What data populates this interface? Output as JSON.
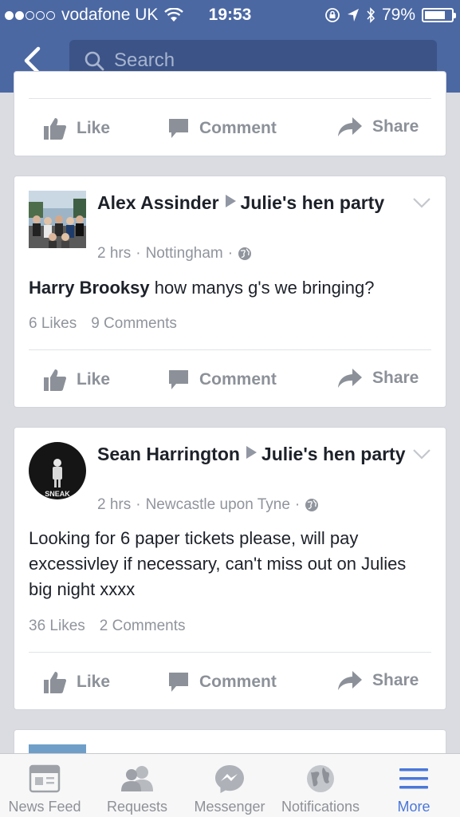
{
  "status_bar": {
    "carrier": "vodafone UK",
    "time": "19:53",
    "battery": "79%",
    "battery_level": 0.79
  },
  "search": {
    "placeholder": "Search"
  },
  "actions": {
    "like": "Like",
    "comment": "Comment",
    "share": "Share"
  },
  "posts": [
    {
      "author": "Alex Assinder",
      "group": "Julie's hen party",
      "time": "2 hrs",
      "location": "Nottingham",
      "mention": "Harry Brooksy",
      "text": " how manys g's we bringing?",
      "likes": "6 Likes",
      "comments": "9 Comments"
    },
    {
      "author": "Sean Harrington",
      "group": "Julie's hen party",
      "time": "2 hrs",
      "location": "Newcastle upon Tyne",
      "text": "Looking for 6 paper tickets please, will pay excessivley if necessary, can't miss out on Julies big night xxxx",
      "likes": "36 Likes",
      "comments": "2 Comments",
      "avatar_text": "SNEAK"
    }
  ],
  "tabs": [
    {
      "label": "News Feed",
      "icon": "news-feed-icon"
    },
    {
      "label": "Requests",
      "icon": "friend-requests-icon"
    },
    {
      "label": "Messenger",
      "icon": "messenger-icon"
    },
    {
      "label": "Notifications",
      "icon": "globe-icon"
    },
    {
      "label": "More",
      "icon": "menu-icon",
      "active": true
    }
  ],
  "colors": {
    "brand": "#4b68a3",
    "active_tab": "#4a77d9",
    "muted": "#90949c"
  }
}
